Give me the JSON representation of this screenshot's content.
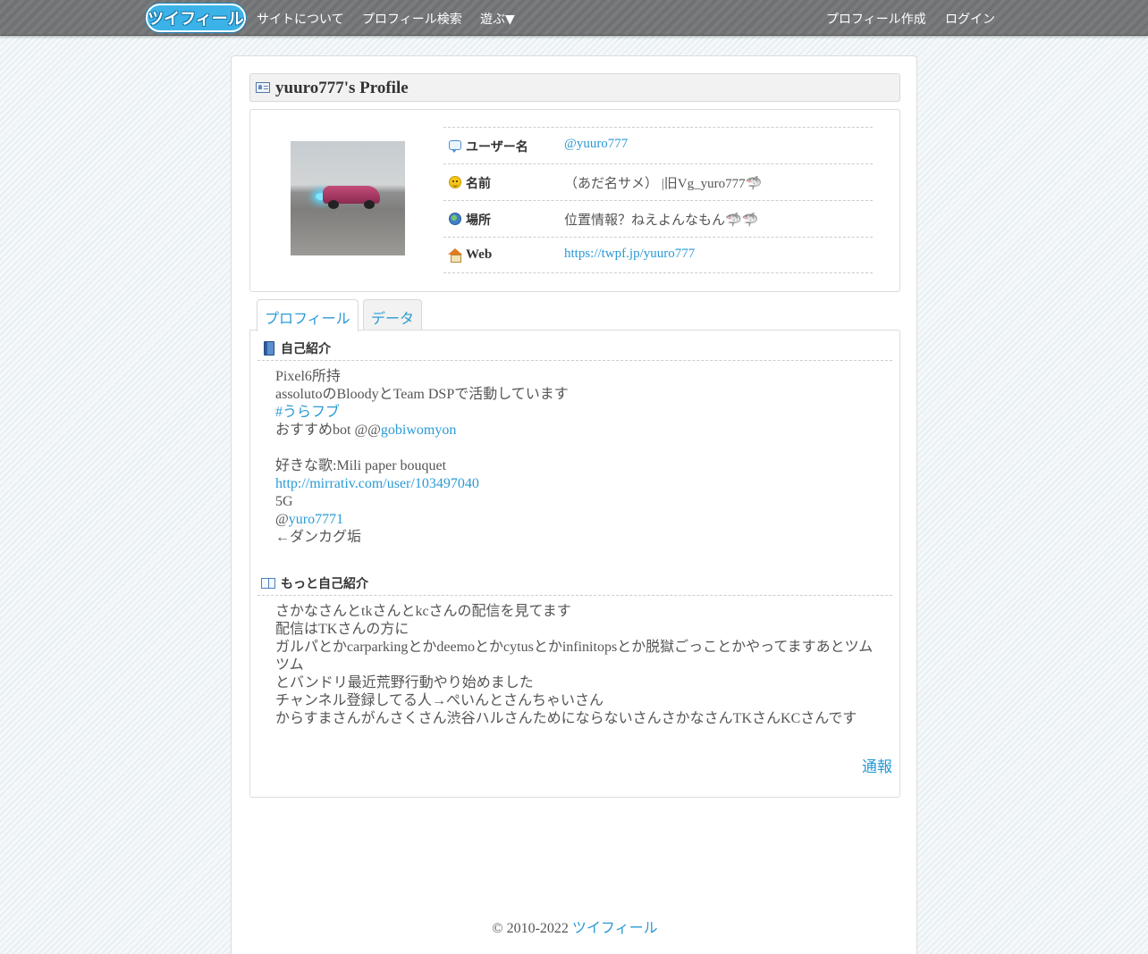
{
  "nav": {
    "logo_text": "ツイフィール",
    "about": "サイトについて",
    "search": "プロフィール検索",
    "play": "遊ぶ▼",
    "create": "プロフィール作成",
    "login": "ログイン"
  },
  "profile": {
    "title": "yuuro777's Profile",
    "rows": [
      {
        "label": "ユーザー名",
        "value": "@yuuro777"
      },
      {
        "label": "名前",
        "value": "（あだ名サメ） |旧Vg_yuro777🦈"
      },
      {
        "label": "場所",
        "value": "位置情報？ねえよんなもん🦈🦈"
      },
      {
        "label": "Web",
        "value": "https://twpf.jp/yuuro777"
      }
    ]
  },
  "tabs": {
    "profile": "プロフィール",
    "data": "データ"
  },
  "intro": {
    "title": "自己紹介",
    "l1": "Pixel6所持",
    "l2": "assolutoのBloodyとTeam DSPで活動しています",
    "l3": "#うらフブ",
    "l4_prefix": "おすすめbot @@",
    "l4_link": "gobiwomyon",
    "l5": "好きな歌:Mili paper bouquet",
    "l6": "http://mirrativ.com/user/103497040",
    "l7": "5G",
    "l8_prefix": "@",
    "l8_link": "yuro7771",
    "l9": "←ダンカグ垢"
  },
  "more": {
    "title": "もっと自己紹介",
    "l1": "さかなさんとtkさんとkcさんの配信を見てます",
    "l2": "配信はTKさんの方に",
    "l3": "ガルパとかcarparkingとかdeemoとかcytusとかinfinitopsとか脱獄ごっことかやってますあとツムツム",
    "l4": "とバンドリ最近荒野行動やり始めました",
    "l5": "チャンネル登録してる人→ぺいんとさんちゃいさん",
    "l6": "からすまさんがんさくさん渋谷ハルさんためにならないさんさかなさんTKさんKCさんです"
  },
  "report": "通報",
  "footer": {
    "copyright": "© 2010-2022 ",
    "site": "ツイフィール"
  }
}
